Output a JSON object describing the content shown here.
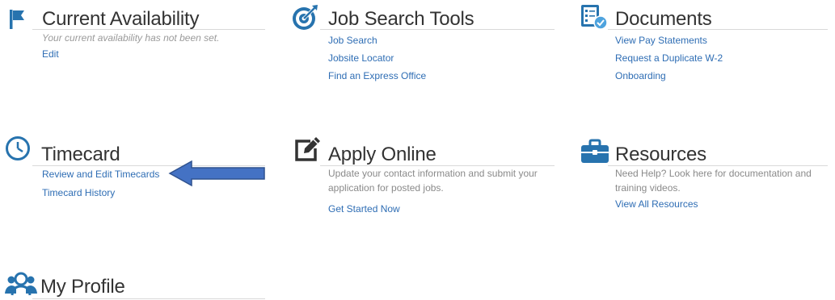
{
  "tiles": {
    "availability": {
      "title": "Current Availability",
      "note": "Your current availability has not been set.",
      "edit": "Edit"
    },
    "job_search": {
      "title": "Job Search Tools",
      "links": [
        "Job Search",
        "Jobsite Locator",
        "Find an Express Office"
      ]
    },
    "documents": {
      "title": "Documents",
      "links": [
        "View Pay Statements",
        "Request a Duplicate W-2",
        "Onboarding"
      ]
    },
    "timecard": {
      "title": "Timecard",
      "links": [
        "Review and Edit Timecards",
        "Timecard History"
      ]
    },
    "apply": {
      "title": "Apply Online",
      "desc_line1": "Update your contact information and submit your",
      "desc_line2": "application for posted jobs.",
      "link": "Get Started Now"
    },
    "resources": {
      "title": "Resources",
      "desc_line1": "Need Help? Look here for documentation and",
      "desc_line2": "training videos.",
      "link": "View All Resources"
    },
    "profile": {
      "title": "My Profile"
    }
  },
  "icons": {
    "availability": "flag-icon",
    "job_search": "target-icon",
    "documents": "document-check-icon",
    "timecard": "clock-icon",
    "apply": "edit-icon",
    "resources": "briefcase-icon",
    "profile": "users-icon",
    "annotation": "arrow-left-icon"
  },
  "colors": {
    "icon": "#2773ae",
    "link": "#2e6db4",
    "title": "#333333",
    "muted": "#8a8a8a",
    "arrow_fill": "#4472c4",
    "arrow_stroke": "#2f528f"
  }
}
